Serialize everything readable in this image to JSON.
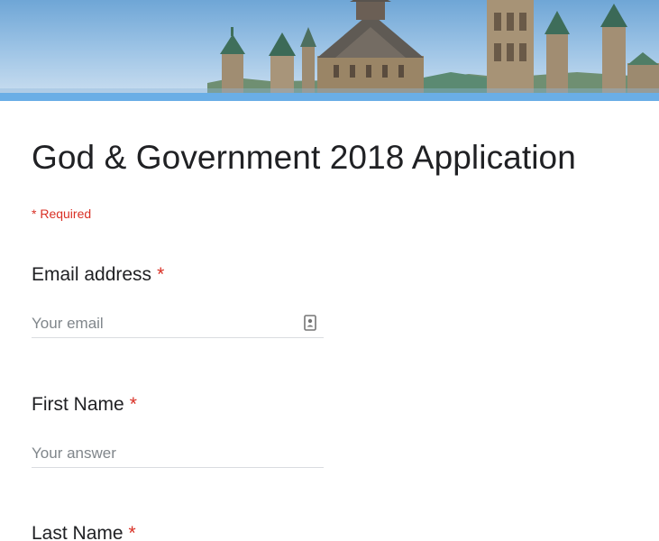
{
  "form": {
    "title": "God & Government 2018 Application",
    "required_note": "* Required"
  },
  "questions": [
    {
      "label": "Email address",
      "required_marker": "*",
      "placeholder": "Your email",
      "icon": "contact-card-icon"
    },
    {
      "label": "First Name",
      "required_marker": "*",
      "placeholder": "Your answer"
    },
    {
      "label": "Last Name",
      "required_marker": "*"
    }
  ],
  "colors": {
    "required_red": "#d93025",
    "accent_blue": "#6aaee6",
    "text": "#202124",
    "placeholder": "#80868b",
    "underline": "#dadce0"
  }
}
